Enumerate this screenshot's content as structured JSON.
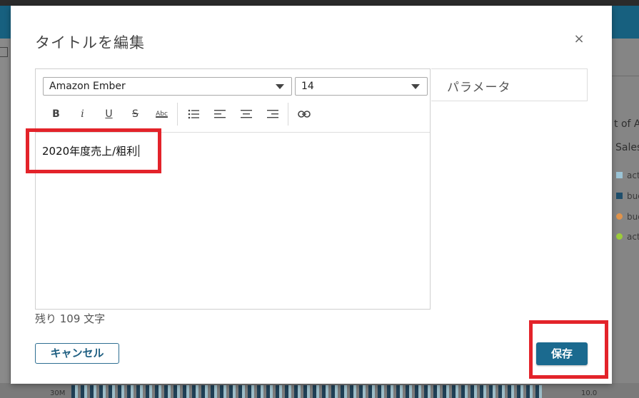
{
  "dialog": {
    "title": "タイトルを編集",
    "close_label": "×",
    "font_family": "Amazon Ember",
    "font_size": "14",
    "editor_text": "2020年度売上/粗利",
    "parameter_tab": "パラメータ",
    "remaining": "残り 109 文字",
    "cancel_label": "キャンセル",
    "save_label": "保存"
  },
  "toolbar": {
    "bold": "B",
    "italic": "i",
    "underline": "U",
    "strike": "S",
    "spellcheck": "Abc"
  },
  "background": {
    "legend_title": "t of A",
    "legend_subtitle": "Sales",
    "legend_items": [
      "act",
      "bud",
      "bud",
      "act"
    ],
    "axis_left": "30M",
    "axis_right": "10.0"
  },
  "colors": {
    "accent": "#1b6a8f",
    "highlight": "#e3232a",
    "legend": [
      "#9cc4d6",
      "#1f4e6b",
      "#e0934b",
      "#9ccc3a"
    ]
  }
}
